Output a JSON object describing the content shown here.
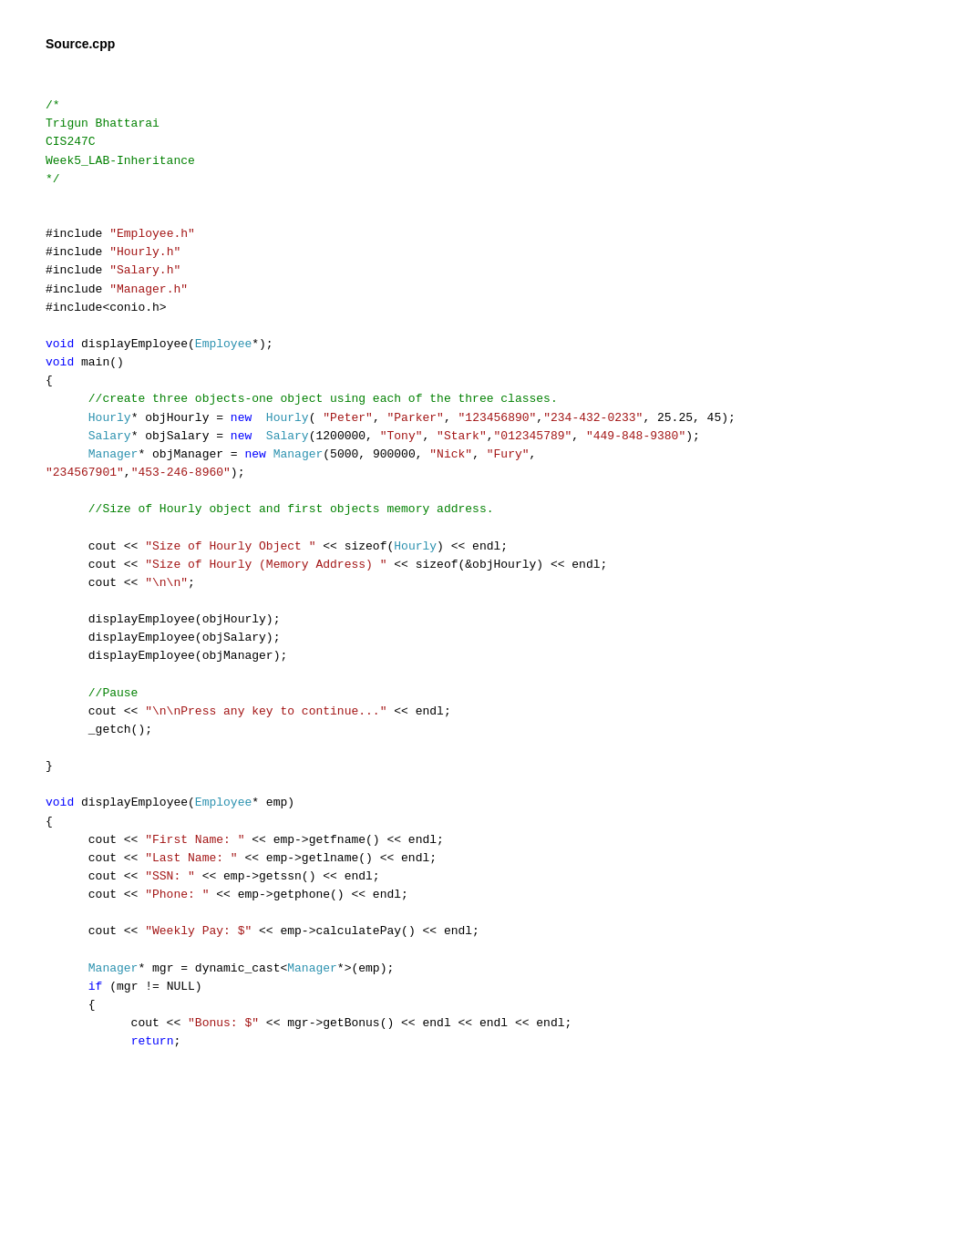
{
  "header": {
    "filename": "Source.cpp"
  },
  "code": {
    "lines": [
      {
        "type": "blank"
      },
      {
        "type": "blank"
      },
      {
        "type": "comment",
        "text": "/*"
      },
      {
        "type": "comment",
        "text": "Trigun Bhattarai"
      },
      {
        "type": "comment",
        "text": "CIS247C"
      },
      {
        "type": "comment",
        "text": "Week5_LAB-Inheritance"
      },
      {
        "type": "comment",
        "text": "*/"
      },
      {
        "type": "blank"
      },
      {
        "type": "blank"
      },
      {
        "type": "include",
        "text": "#include \"Employee.h\""
      },
      {
        "type": "include",
        "text": "#include \"Hourly.h\""
      },
      {
        "type": "include",
        "text": "#include \"Salary.h\""
      },
      {
        "type": "include",
        "text": "#include \"Manager.h\""
      },
      {
        "type": "include_sys",
        "text": "#include<conio.h>"
      },
      {
        "type": "blank"
      },
      {
        "type": "code",
        "text": "void displayEmployee(Employee*);"
      },
      {
        "type": "code",
        "text": "void main()"
      },
      {
        "type": "code",
        "text": "{"
      },
      {
        "type": "code_indent1",
        "text": "      //create three objects-one object using each of the three classes."
      },
      {
        "type": "code_indent1",
        "text": "      Hourly* objHourly = new  Hourly( \"Peter\", \"Parker\", \"123456890\",\"234-432-0233\", 25.25, 45);"
      },
      {
        "type": "code_indent1",
        "text": "      Salary* objSalary = new  Salary(1200000, \"Tony\", \"Stark\",\"012345789\", \"449-848-9380\");"
      },
      {
        "type": "code_indent1",
        "text": "      Manager* objManager = new Manager(5000, 900000, \"Nick\", \"Fury\", \"234567901\",\"453-246-8960\");"
      },
      {
        "type": "blank"
      },
      {
        "type": "code_indent1",
        "text": "      //Size of Hourly object and first objects memory address."
      },
      {
        "type": "blank"
      },
      {
        "type": "code_indent1",
        "text": "      cout << \"Size of Hourly Object \" << sizeof(Hourly) << endl;"
      },
      {
        "type": "code_indent1",
        "text": "      cout << \"Size of Hourly (Memory Address) \" << sizeof(&objHourly) << endl;"
      },
      {
        "type": "code_indent1",
        "text": "      cout << \"\\n\\n\";"
      },
      {
        "type": "blank"
      },
      {
        "type": "code_indent1",
        "text": "      displayEmployee(objHourly);"
      },
      {
        "type": "code_indent1",
        "text": "      displayEmployee(objSalary);"
      },
      {
        "type": "code_indent1",
        "text": "      displayEmployee(objManager);"
      },
      {
        "type": "blank"
      },
      {
        "type": "code_indent1",
        "text": "      //Pause"
      },
      {
        "type": "code_indent1",
        "text": "      cout << \"\\n\\nPress any key to continue...\" << endl;"
      },
      {
        "type": "code_indent1",
        "text": "      _getch();"
      },
      {
        "type": "blank"
      },
      {
        "type": "code",
        "text": "}"
      },
      {
        "type": "blank"
      },
      {
        "type": "code",
        "text": "void displayEmployee(Employee* emp)"
      },
      {
        "type": "code",
        "text": "{"
      },
      {
        "type": "code_indent1",
        "text": "      cout << \"First Name: \" << emp->getfname() << endl;"
      },
      {
        "type": "code_indent1",
        "text": "      cout << \"Last Name: \" << emp->getlname() << endl;"
      },
      {
        "type": "code_indent1",
        "text": "      cout << \"SSN: \" << emp->getssn() << endl;"
      },
      {
        "type": "code_indent1",
        "text": "      cout << \"Phone: \" << emp->getphone() << endl;"
      },
      {
        "type": "blank"
      },
      {
        "type": "code_indent1",
        "text": "      cout << \"Weekly Pay: $\" << emp->calculatePay() << endl;"
      },
      {
        "type": "blank"
      },
      {
        "type": "code_indent1",
        "text": "      Manager* mgr = dynamic_cast<Manager*>(emp);"
      },
      {
        "type": "code_indent1",
        "text": "      if (mgr != NULL)"
      },
      {
        "type": "code_indent1",
        "text": "      {"
      },
      {
        "type": "code_indent2",
        "text": "            cout << \"Bonus: $\" << mgr->getBonus() << endl << endl << endl;"
      },
      {
        "type": "code_indent2",
        "text": "            return;"
      }
    ]
  }
}
